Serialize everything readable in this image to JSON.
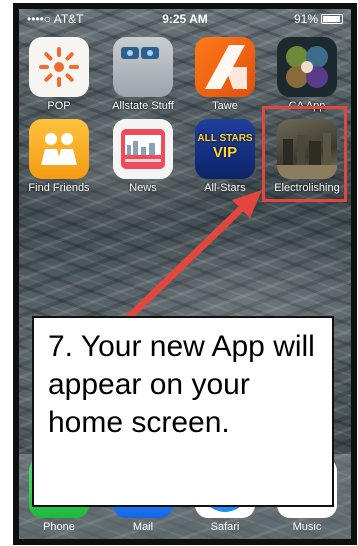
{
  "status_bar": {
    "carrier": "••••○ AT&T",
    "time": "9:25 AM",
    "battery": "91%"
  },
  "apps": [
    {
      "label": "POP",
      "icon": "sun-icon"
    },
    {
      "label": "Allstate Stuff",
      "icon": "folder-icon"
    },
    {
      "label": "Tawe",
      "icon": "tawe-logo-icon"
    },
    {
      "label": "CA App",
      "icon": "ca-app-icon"
    },
    {
      "label": "Find Friends",
      "icon": "find-friends-icon"
    },
    {
      "label": "News",
      "icon": "news-icon"
    },
    {
      "label": "All-Stars",
      "icon": "all-stars-vip-icon"
    },
    {
      "label": "Electrolishing",
      "icon": "electropolishing-photo-icon"
    }
  ],
  "allstars_icon_text": {
    "line1": "ALL STARS",
    "line2": "VIP"
  },
  "dock": [
    {
      "label": "Phone",
      "icon": "phone-icon"
    },
    {
      "label": "Mail",
      "icon": "mail-icon"
    },
    {
      "label": "Safari",
      "icon": "safari-icon"
    },
    {
      "label": "Music",
      "icon": "music-icon"
    }
  ],
  "callout": {
    "text": "7. Your new App will appear on your home screen."
  },
  "colors": {
    "highlight": "#e3463d",
    "arrow": "#e3463d"
  }
}
